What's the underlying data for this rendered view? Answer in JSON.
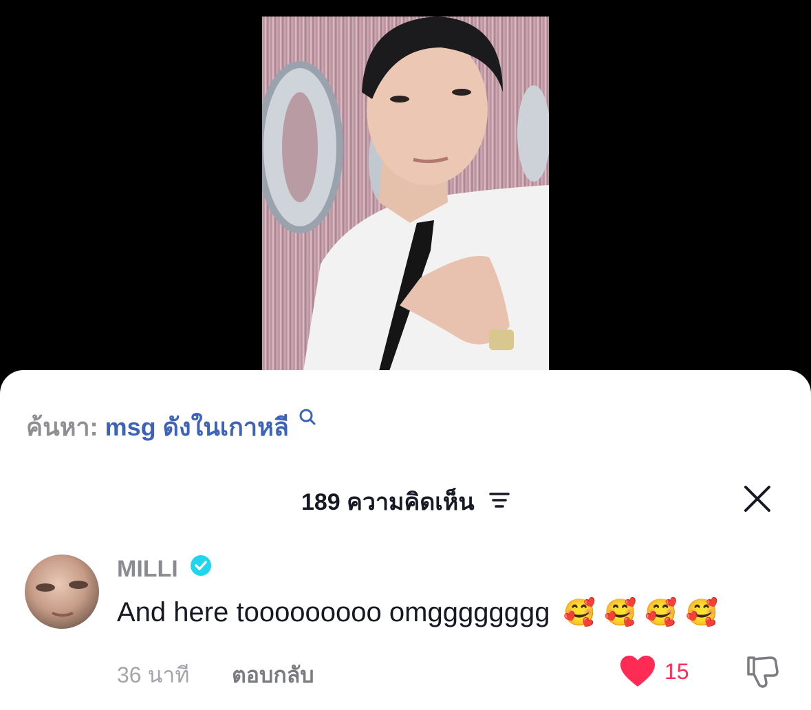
{
  "video": {
    "description_visible": false
  },
  "search": {
    "prefix": "ค้นหา:",
    "term": "msg ดังในเกาหลี",
    "icon": "search-icon"
  },
  "comments_header": {
    "title": "189 ความคิดเห็น",
    "sort_icon": "sort-icon",
    "close_icon": "close-icon"
  },
  "comment": {
    "username": "MILLI",
    "verified_icon": "verified-badge-icon",
    "text": "And here tooooooooo omgggggggg",
    "emoji": "🥰 🥰 🥰 🥰",
    "time": "36 นาที",
    "reply_label": "ตอบกลับ",
    "like_count": "15",
    "like_icon": "heart-icon",
    "dislike_icon": "thumbs-down-icon"
  },
  "colors": {
    "accent_search": "#3d63b8",
    "like": "#fe2c55",
    "verified": "#20d5ec"
  }
}
